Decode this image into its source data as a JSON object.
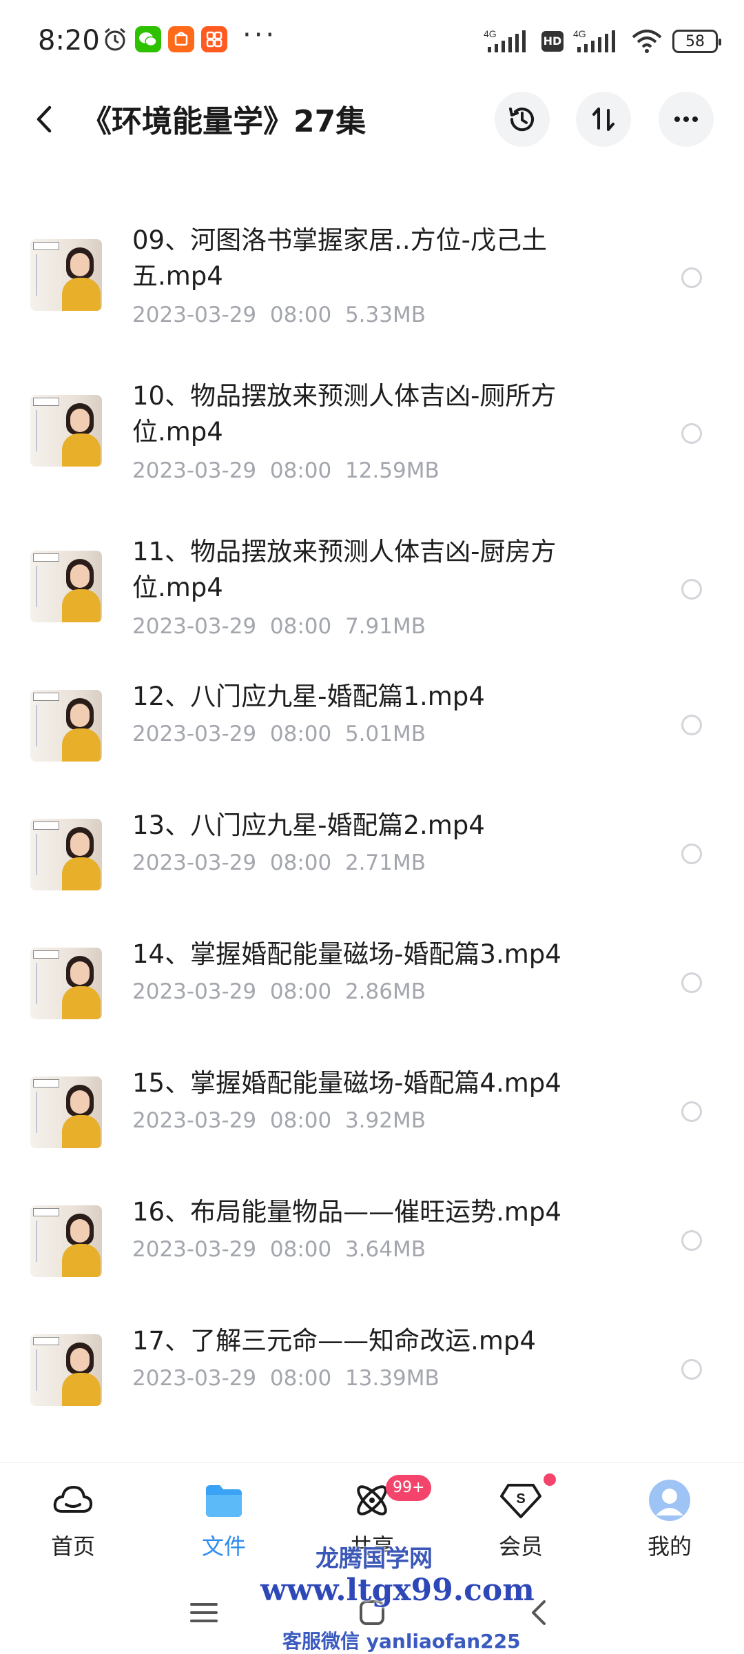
{
  "status_bar": {
    "time": "8:20",
    "more": "···",
    "network1": "4G",
    "hd": "HD",
    "network2": "4G",
    "battery": "58"
  },
  "header": {
    "title": "《环境能量学》27集"
  },
  "files": [
    {
      "name": "09、河图洛书掌握家居..方位-戊己土五.mp4",
      "date": "2023-03-29",
      "time": "08:00",
      "size": "5.33MB"
    },
    {
      "name": "10、物品摆放来预测人体吉凶-厕所方位.mp4",
      "date": "2023-03-29",
      "time": "08:00",
      "size": "12.59MB"
    },
    {
      "name": "11、物品摆放来预测人体吉凶-厨房方位.mp4",
      "date": "2023-03-29",
      "time": "08:00",
      "size": "7.91MB"
    },
    {
      "name": "12、八门应九星-婚配篇1.mp4",
      "date": "2023-03-29",
      "time": "08:00",
      "size": "5.01MB"
    },
    {
      "name": "13、八门应九星-婚配篇2.mp4",
      "date": "2023-03-29",
      "time": "08:00",
      "size": "2.71MB"
    },
    {
      "name": "14、掌握婚配能量磁场-婚配篇3.mp4",
      "date": "2023-03-29",
      "time": "08:00",
      "size": "2.86MB"
    },
    {
      "name": "15、掌握婚配能量磁场-婚配篇4.mp4",
      "date": "2023-03-29",
      "time": "08:00",
      "size": "3.92MB"
    },
    {
      "name": "16、布局能量物品——催旺运势.mp4",
      "date": "2023-03-29",
      "time": "08:00",
      "size": "3.64MB"
    },
    {
      "name": "17、了解三元命——知命改运.mp4",
      "date": "2023-03-29",
      "time": "08:00",
      "size": "13.39MB"
    }
  ],
  "bottom_nav": {
    "items": [
      {
        "label": "首页",
        "icon": "home-cloud-icon"
      },
      {
        "label": "文件",
        "icon": "folder-icon"
      },
      {
        "label": "共享",
        "icon": "share-atom-icon"
      },
      {
        "label": "会员",
        "icon": "vip-diamond-icon"
      },
      {
        "label": "我的",
        "icon": "avatar-icon"
      }
    ],
    "share_badge": "99+",
    "active_color": "#2d8cf0"
  },
  "watermark": {
    "line1": "龙腾国学网",
    "line2": "www.ltgx99.com",
    "line3": "客服微信 yanliaofan225"
  }
}
